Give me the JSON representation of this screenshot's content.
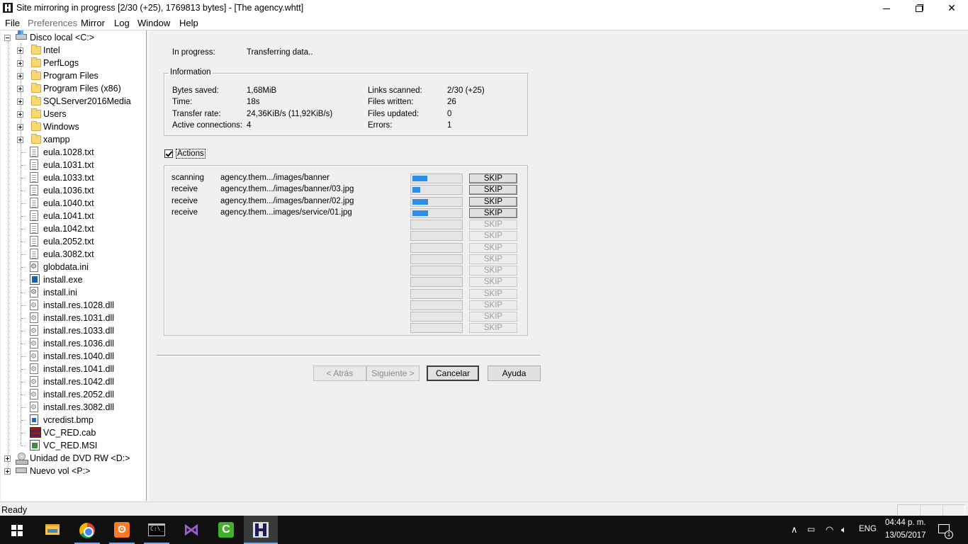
{
  "window": {
    "title": "Site mirroring in progress [2/30 (+25), 1769813 bytes] - [The agency.whtt]",
    "minimize": "—",
    "close": "✕"
  },
  "menu": [
    "File",
    "Preferences",
    "Mirror",
    "Log",
    "Window",
    "Help"
  ],
  "tree": {
    "root": "Disco local <C:>",
    "folders": [
      "Intel",
      "PerfLogs",
      "Program Files",
      "Program Files (x86)",
      "SQLServer2016Media",
      "Users",
      "Windows",
      "xampp"
    ],
    "files": [
      {
        "name": "eula.1028.txt",
        "icon": "text-file-icon"
      },
      {
        "name": "eula.1031.txt",
        "icon": "text-file-icon"
      },
      {
        "name": "eula.1033.txt",
        "icon": "text-file-icon"
      },
      {
        "name": "eula.1036.txt",
        "icon": "text-file-icon"
      },
      {
        "name": "eula.1040.txt",
        "icon": "text-file-icon"
      },
      {
        "name": "eula.1041.txt",
        "icon": "text-file-icon"
      },
      {
        "name": "eula.1042.txt",
        "icon": "text-file-icon"
      },
      {
        "name": "eula.2052.txt",
        "icon": "text-file-icon"
      },
      {
        "name": "eula.3082.txt",
        "icon": "text-file-icon"
      },
      {
        "name": "globdata.ini",
        "icon": "settings-file-icon"
      },
      {
        "name": "install.exe",
        "icon": "installer-icon"
      },
      {
        "name": "install.ini",
        "icon": "settings-file-icon"
      },
      {
        "name": "install.res.1028.dll",
        "icon": "dll-file-icon"
      },
      {
        "name": "install.res.1031.dll",
        "icon": "dll-file-icon"
      },
      {
        "name": "install.res.1033.dll",
        "icon": "dll-file-icon"
      },
      {
        "name": "install.res.1036.dll",
        "icon": "dll-file-icon"
      },
      {
        "name": "install.res.1040.dll",
        "icon": "dll-file-icon"
      },
      {
        "name": "install.res.1041.dll",
        "icon": "dll-file-icon"
      },
      {
        "name": "install.res.1042.dll",
        "icon": "dll-file-icon"
      },
      {
        "name": "install.res.2052.dll",
        "icon": "dll-file-icon"
      },
      {
        "name": "install.res.3082.dll",
        "icon": "dll-file-icon"
      },
      {
        "name": "vcredist.bmp",
        "icon": "bitmap-file-icon"
      },
      {
        "name": "VC_RED.cab",
        "icon": "cabinet-file-icon"
      },
      {
        "name": "VC_RED.MSI",
        "icon": "msi-installer-icon"
      }
    ],
    "drives": [
      "Unidad de DVD RW <D:>",
      "Nuevo vol <P:>"
    ]
  },
  "progress": {
    "in_progress_label": "In progress:",
    "in_progress_value": "Transferring data..",
    "info_title": "Information",
    "bytes_saved_label": "Bytes saved:",
    "bytes_saved": "1,68MiB",
    "time_label": "Time:",
    "time": "18s",
    "transfer_rate_label": "Transfer rate:",
    "transfer_rate": "24,36KiB/s (11,92KiB/s)",
    "active_connections_label": "Active connections:",
    "active_connections": "4",
    "links_scanned_label": "Links scanned:",
    "links_scanned": "2/30 (+25)",
    "files_written_label": "Files written:",
    "files_written": "26",
    "files_updated_label": "Files updated:",
    "files_updated": "0",
    "errors_label": "Errors:",
    "errors": "1",
    "actions_label": "Actions",
    "actions_checked": true,
    "skip_label": "SKIP",
    "progress_color": "#2b8ee8",
    "rows": [
      {
        "action": "scanning",
        "url": "agency.them.../images/banner",
        "progress": 0.3
      },
      {
        "action": "receive",
        "url": "agency.them.../images/banner/03.jpg",
        "progress": 0.15
      },
      {
        "action": "receive",
        "url": "agency.them.../images/banner/02.jpg",
        "progress": 0.32
      },
      {
        "action": "receive",
        "url": "agency.them...images/service/01.jpg",
        "progress": 0.32
      },
      {
        "action": "",
        "url": "",
        "progress": 0
      },
      {
        "action": "",
        "url": "",
        "progress": 0
      },
      {
        "action": "",
        "url": "",
        "progress": 0
      },
      {
        "action": "",
        "url": "",
        "progress": 0
      },
      {
        "action": "",
        "url": "",
        "progress": 0
      },
      {
        "action": "",
        "url": "",
        "progress": 0
      },
      {
        "action": "",
        "url": "",
        "progress": 0
      },
      {
        "action": "",
        "url": "",
        "progress": 0
      },
      {
        "action": "",
        "url": "",
        "progress": 0
      },
      {
        "action": "",
        "url": "",
        "progress": 0
      }
    ]
  },
  "buttons": {
    "back": "< Atrás",
    "next": "Siguiente >",
    "cancel": "Cancelar",
    "help": "Ayuda"
  },
  "status": "Ready",
  "taskbar": {
    "apps": [
      "start-icon",
      "file-explorer-icon",
      "chrome-icon",
      "xampp-icon",
      "command-prompt-icon",
      "visual-studio-icon",
      "camtasia-icon",
      "httrack-icon"
    ],
    "xampp_glyph": "ʘ",
    "cmd_glyph": "C:\\_",
    "camtasia_glyph": "C",
    "vs_glyph": "⋈",
    "language": "ENG",
    "time": "04:44 p. m.",
    "date": "13/05/2017",
    "notifications": "1",
    "tray_up": "∧"
  }
}
